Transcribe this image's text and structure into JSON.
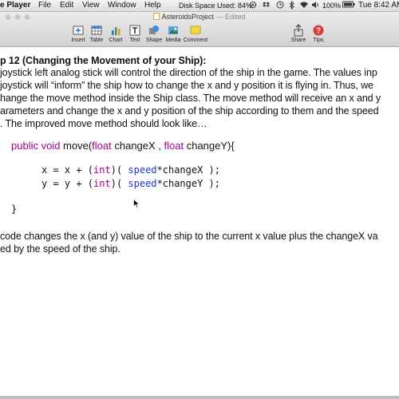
{
  "menubar": {
    "app_name": "e Player",
    "items": [
      "File",
      "Edit",
      "View",
      "Window",
      "Help"
    ],
    "disk_usage": "Disk Space Used: 84%",
    "battery": "100%",
    "clock": "Tue 8:42 AM"
  },
  "toolbar": {
    "doc_name": "AsteroidsProject",
    "doc_status": "— Edited",
    "buttons": [
      "Insert",
      "Table",
      "Chart",
      "Text",
      "Shape",
      "Media",
      "Comment",
      "Share",
      "Tips"
    ]
  },
  "doc": {
    "heading": "p 12 (Changing the Movement of your Ship):",
    "para1": [
      "joystick left analog stick will control the direction of the ship in the game.  The values inp",
      "joystick will “inform” the ship how to change the x and y position it is flying in.  Thus, we",
      "hange the move method inside the Ship class.  The move method will receive an x and y",
      "arameters and change the x and y position of the ship according to them and the speed",
      ".  The improved move method should look like…"
    ],
    "code": {
      "sig_kw1": "public void",
      "sig_name": " move(",
      "sig_kw2": "float",
      "sig_p1": " changeX , ",
      "sig_kw3": "float",
      "sig_p2": " changeY){",
      "l2_a": "x = x + (",
      "l2_kw": "int",
      "l2_b": ")( ",
      "l2_fld": "speed",
      "l2_c": "*changeX );",
      "l3_a": "y = y + (",
      "l3_kw": "int",
      "l3_b": ")( ",
      "l3_fld": "speed",
      "l3_c": "*changeY );",
      "close": "}"
    },
    "para2": [
      "code changes the x (and y) value of the ship to the current x value plus the changeX va",
      "ed by the speed of the ship."
    ]
  },
  "colors": {
    "keyword": "#a4008f",
    "field": "#1f35c8"
  }
}
